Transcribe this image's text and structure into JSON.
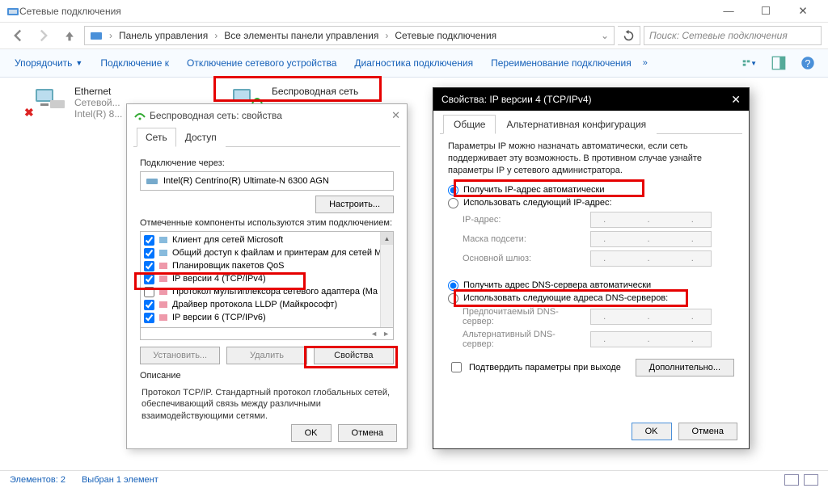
{
  "window": {
    "title": "Сетевые подключения",
    "minimize": "—",
    "maximize": "☐",
    "close": "✕"
  },
  "breadcrumb": {
    "item1": "Панель управления",
    "item2": "Все элементы панели управления",
    "item3": "Сетевые подключения"
  },
  "search": {
    "placeholder": "Поиск: Сетевые подключения"
  },
  "toolbar": {
    "organize": "Упорядочить",
    "connectTo": "Подключение к",
    "disableDevice": "Отключение сетевого устройства",
    "diagnose": "Диагностика подключения",
    "rename": "Переименование подключения"
  },
  "net": {
    "eth": {
      "name": "Ethernet",
      "line2": "Сетевой...",
      "line3": "Intel(R) 8..."
    },
    "wifi": {
      "name": "Беспроводная сеть"
    }
  },
  "dlg1": {
    "title": "Беспроводная сеть: свойства",
    "tabNet": "Сеть",
    "tabAccess": "Доступ",
    "connectVia": "Подключение через:",
    "adapter": "Intel(R) Centrino(R) Ultimate-N 6300 AGN",
    "configure": "Настроить...",
    "componentsLabel": "Отмеченные компоненты используются этим подключением:",
    "comp": {
      "c1": "Клиент для сетей Microsoft",
      "c2": "Общий доступ к файлам и принтерам для сетей Mi",
      "c3": "Планировщик пакетов QoS",
      "c4": "IP версии 4 (TCP/IPv4)",
      "c5": "Протокол мультиплексора сетевого адаптера (Ma",
      "c6": "Драйвер протокола LLDP (Майкрософт)",
      "c7": "IP версии 6 (TCP/IPv6)"
    },
    "install": "Установить...",
    "remove": "Удалить",
    "properties": "Свойства",
    "descLabel": "Описание",
    "descText": "Протокол TCP/IP. Стандартный протокол глобальных сетей, обеспечивающий связь между различными взаимодействующими сетями.",
    "ok": "OK",
    "cancel": "Отмена"
  },
  "dlg2": {
    "title": "Свойства: IP версии 4 (TCP/IPv4)",
    "tabGeneral": "Общие",
    "tabAlt": "Альтернативная конфигурация",
    "info": "Параметры IP можно назначать автоматически, если сеть поддерживает эту возможность. В противном случае узнайте параметры IP у сетевого администратора.",
    "ipAuto": "Получить IP-адрес автоматически",
    "ipManual": "Использовать следующий IP-адрес:",
    "ipAddr": "IP-адрес:",
    "mask": "Маска подсети:",
    "gateway": "Основной шлюз:",
    "dnsAuto": "Получить адрес DNS-сервера автоматически",
    "dnsManual": "Использовать следующие адреса DNS-серверов:",
    "dns1": "Предпочитаемый DNS-сервер:",
    "dns2": "Альтернативный DNS-сервер:",
    "validate": "Подтвердить параметры при выходе",
    "advanced": "Дополнительно...",
    "ok": "OK",
    "cancel": "Отмена",
    "dotted": ".     .     ."
  },
  "status": {
    "items": "Элементов: 2",
    "selected": "Выбран 1 элемент"
  }
}
